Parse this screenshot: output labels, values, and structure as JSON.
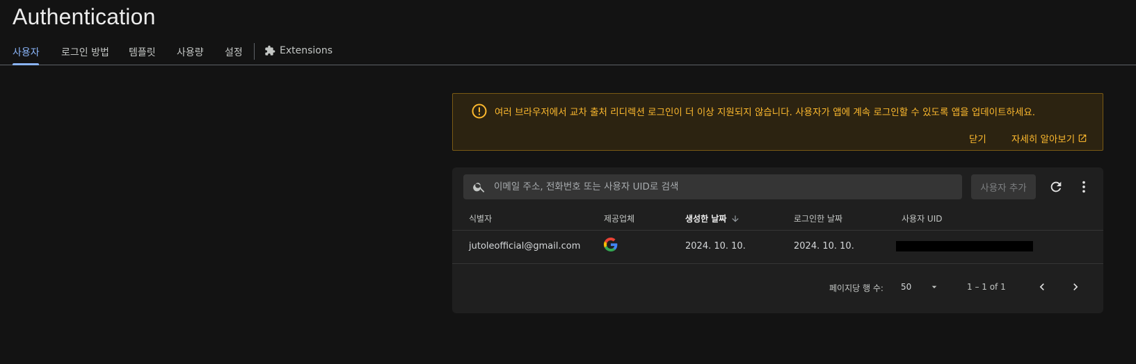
{
  "page": {
    "title": "Authentication"
  },
  "tabs": [
    {
      "label": "사용자",
      "active": true
    },
    {
      "label": "로그인 방법"
    },
    {
      "label": "템플릿"
    },
    {
      "label": "사용량"
    },
    {
      "label": "설정"
    },
    {
      "label": "Extensions",
      "icon": "extension-icon"
    }
  ],
  "banner": {
    "icon": "warning-circle-icon",
    "message": "여러 브라우저에서 교차 출처 리디렉션 로그인이 더 이상 지원되지 않습니다. 사용자가 앱에 계속 로그인할 수 있도록 앱을 업데이트하세요.",
    "close_label": "닫기",
    "learn_more_label": "자세히 알아보기",
    "color": "#fdb92e"
  },
  "search": {
    "placeholder": "이메일 주소, 전화번호 또는 사용자 UID로 검색",
    "value": ""
  },
  "toolbar": {
    "add_user_label": "사용자 추가",
    "refresh_icon": "refresh-icon",
    "more_icon": "more-vert-icon"
  },
  "table": {
    "columns": [
      "식별자",
      "제공업체",
      "생성한 날짜",
      "로그인한 날짜",
      "사용자 UID"
    ],
    "sorted_column": "생성한 날짜",
    "rows": [
      {
        "identifier": "jutoleofficial@gmail.com",
        "provider": "google-icon",
        "created": "2024. 10. 10.",
        "signed_in": "2024. 10. 10.",
        "uid": ""
      }
    ]
  },
  "pagination": {
    "rows_per_page_label": "페이지당 행 수:",
    "rows_per_page": "50",
    "range": "1 – 1 of 1"
  },
  "colors": {
    "accent": "#8ab4f8",
    "background": "#131313",
    "card": "#1f1f1f",
    "warning_bg": "#2c2311"
  }
}
